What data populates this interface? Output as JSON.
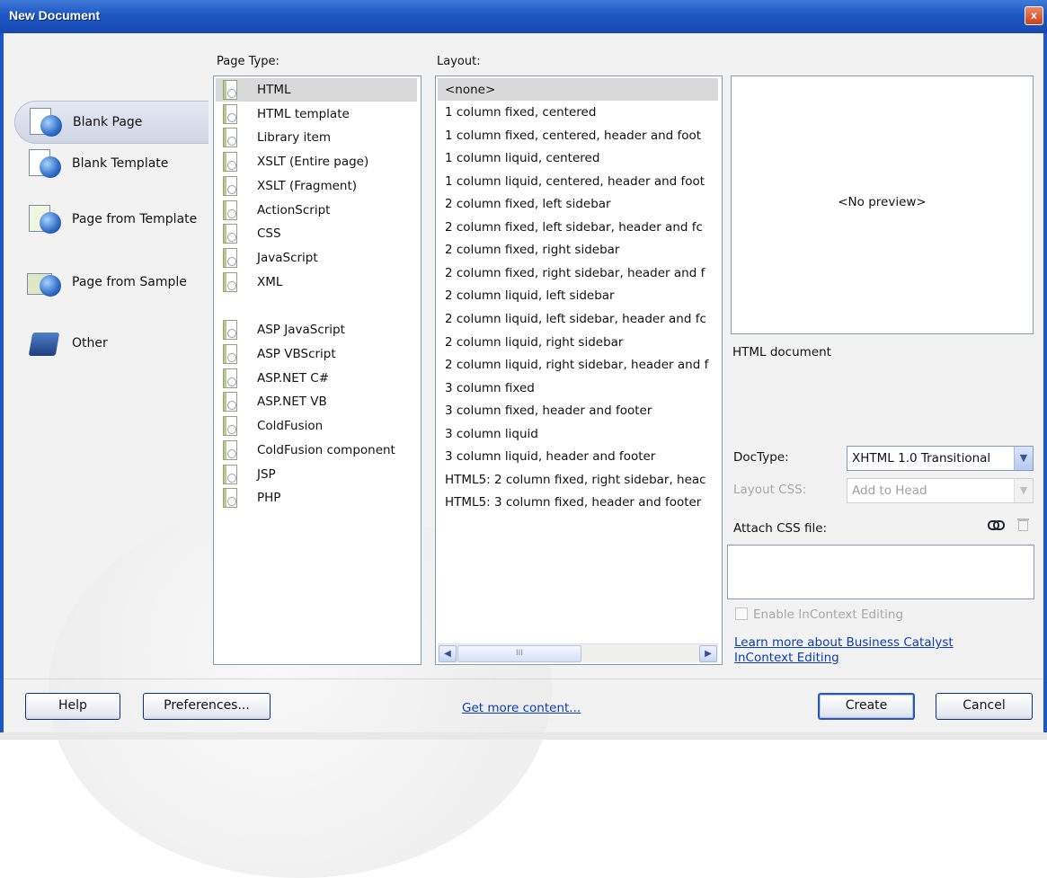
{
  "window": {
    "title": "New Document",
    "close_glyph": "x"
  },
  "categories": [
    {
      "label": "Blank Page",
      "icon": "blank-page-icon",
      "selected": true
    },
    {
      "label": "Blank Template",
      "icon": "blank-template-icon",
      "selected": false
    },
    {
      "label": "Page from Template",
      "icon": "page-from-template-icon",
      "selected": false
    },
    {
      "label": "Page from Sample",
      "icon": "page-from-sample-icon",
      "selected": false
    },
    {
      "label": "Other",
      "icon": "other-icon",
      "selected": false
    }
  ],
  "page_type": {
    "header": "Page Type:",
    "items": [
      "HTML",
      "HTML template",
      "Library item",
      "XSLT (Entire page)",
      "XSLT (Fragment)",
      "ActionScript",
      "CSS",
      "JavaScript",
      "XML",
      "ASP JavaScript",
      "ASP VBScript",
      "ASP.NET C#",
      "ASP.NET VB",
      "ColdFusion",
      "ColdFusion component",
      "JSP",
      "PHP"
    ],
    "selected": "HTML"
  },
  "layout": {
    "header": "Layout:",
    "items": [
      "<none>",
      "1 column fixed, centered",
      "1 column fixed, centered, header and foot",
      "1 column liquid, centered",
      "1 column liquid, centered, header and foot",
      "2 column fixed, left sidebar",
      "2 column fixed, left sidebar, header and fc",
      "2 column fixed, right sidebar",
      "2 column fixed, right sidebar, header and f",
      "2 column liquid, left sidebar",
      "2 column liquid, left sidebar, header and fc",
      "2 column liquid, right sidebar",
      "2 column liquid, right sidebar, header and f",
      "3 column fixed",
      "3 column fixed, header and footer",
      "3 column liquid",
      "3 column liquid, header and footer",
      "HTML5: 2 column fixed, right sidebar, heac",
      "HTML5: 3 column fixed, header and footer"
    ],
    "selected": "<none>",
    "scroll_thumb_glyph": "III"
  },
  "preview": {
    "text": "<No preview>",
    "description": "HTML document"
  },
  "doctype": {
    "label": "DocType:",
    "value": "XHTML 1.0 Transitional"
  },
  "layout_css": {
    "label": "Layout CSS:",
    "value": "Add to Head",
    "enabled": false
  },
  "attach_css": {
    "label": "Attach CSS file:"
  },
  "incontext": {
    "label": "Enable InContext Editing",
    "checked": false,
    "enabled": false
  },
  "learn_more": {
    "line1": "Learn more about Business Catalyst",
    "line2": "InContext Editing"
  },
  "buttons": {
    "help": "Help",
    "preferences": "Preferences...",
    "get_more": "Get more content...",
    "create": "Create",
    "cancel": "Cancel"
  }
}
